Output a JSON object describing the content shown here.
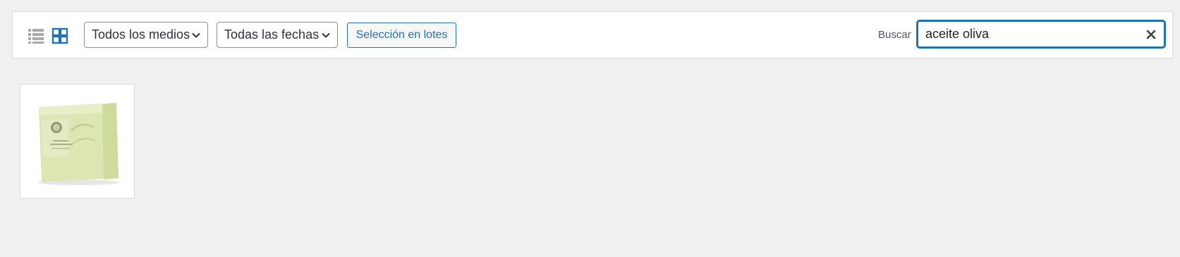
{
  "toolbar": {
    "list_view_icon": "list-view-icon",
    "grid_view_icon": "grid-view-icon",
    "media_filter": {
      "selected": "Todos los medios"
    },
    "date_filter": {
      "selected": "Todas las fechas"
    },
    "bulk_select_label": "Selección en lotes",
    "search": {
      "label": "Buscar",
      "value": "aceite oliva",
      "clear_icon": "close-icon"
    }
  },
  "attachments": [
    {
      "kind": "image",
      "subject": "olive oil soap box"
    }
  ],
  "colors": {
    "accent": "#2271b1",
    "background": "#f0f0f1",
    "toolbar_bg": "#ffffff",
    "border": "#dcdcde"
  }
}
